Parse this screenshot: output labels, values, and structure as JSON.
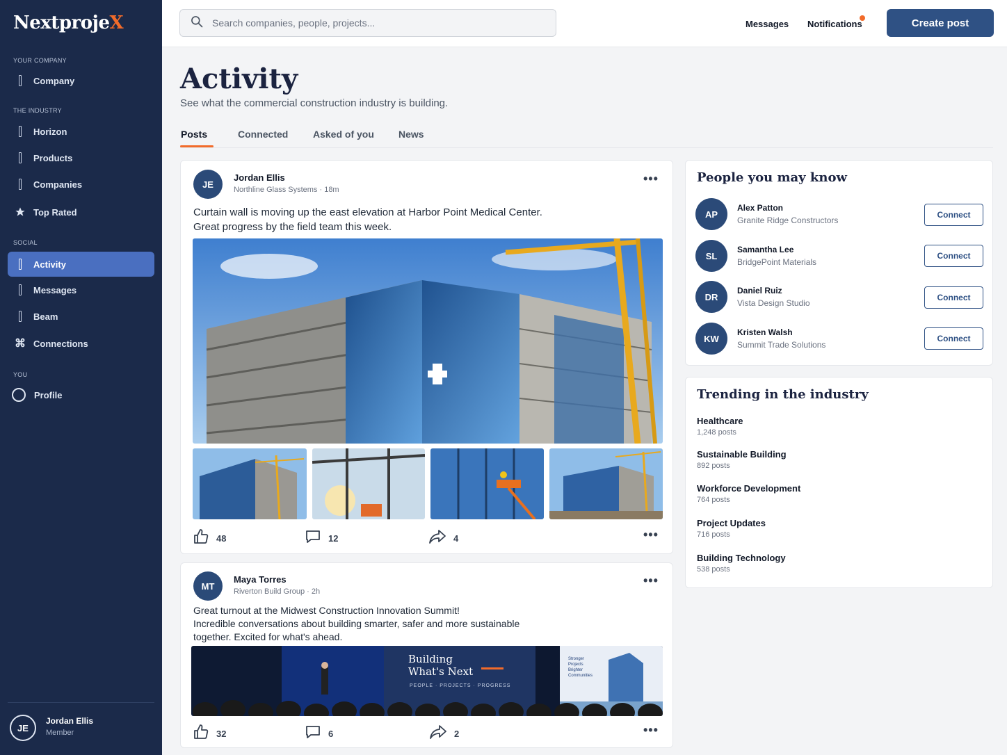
{
  "brand": {
    "logo_main": "Nextproje",
    "logo_x": "X",
    "accent": "#f26b2a",
    "primary": "#2f5184",
    "sidebar_bg": "#1b2a4a"
  },
  "sidebar": {
    "sections": {
      "company": "YOUR COMPANY",
      "industry": "THE INDUSTRY",
      "social": "SOCIAL",
      "you": "YOU"
    },
    "items": [
      {
        "label": "Company",
        "icon": "bar-icon"
      },
      {
        "label": "Horizon",
        "icon": "bar-icon"
      },
      {
        "label": "Products",
        "icon": "bar-icon"
      },
      {
        "label": "Companies",
        "icon": "bar-icon"
      },
      {
        "label": "Top Rated",
        "icon": "star-icon"
      },
      {
        "label": "Activity",
        "icon": "bar-icon",
        "active": true
      },
      {
        "label": "Messages",
        "icon": "bar-icon"
      },
      {
        "label": "Beam",
        "icon": "bar-icon"
      },
      {
        "label": "Connections",
        "icon": "command-icon"
      },
      {
        "label": "Profile",
        "icon": "circle-icon"
      }
    ],
    "user": {
      "initials": "JE",
      "name": "Jordan Ellis",
      "role": "Member"
    }
  },
  "topbar": {
    "search_placeholder": "Search companies, people, projects...",
    "messages": "Messages",
    "notifications": "Notifications",
    "create": "Create post"
  },
  "main": {
    "title": "Activity",
    "subtitle": "See what the commercial construction industry is building.",
    "tabs": [
      "Posts",
      "Connected",
      "Asked of you",
      "News"
    ]
  },
  "posts": [
    {
      "initials": "JE",
      "name": "Jordan Ellis",
      "meta": "Northline Glass Systems · 18m",
      "text_1": "Curtain wall is moving up the east elevation at Harbor Point Medical Center.",
      "text_2": "Great progress by the field team this week.",
      "likes": "48",
      "comments": "12",
      "shares": "4"
    },
    {
      "initials": "MT",
      "name": "Maya Torres",
      "meta": "Riverton Build Group · 2h",
      "text_1": "Great turnout at the Midwest Construction Innovation Summit!",
      "text_2": "Incredible conversations about building smarter, safer and more sustainable",
      "text_3": "together. Excited for what's ahead.",
      "banner_1": "Building",
      "banner_2": "What's Next",
      "banner_tags": "PEOPLE  ·  PROJECTS  ·  PROGRESS",
      "side_banner": [
        "Stronger",
        "Projects",
        "Brighter",
        "Communities"
      ],
      "likes": "32",
      "comments": "6",
      "shares": "2"
    }
  ],
  "people": {
    "title": "People you may know",
    "connect_label": "Connect",
    "list": [
      {
        "initials": "AP",
        "name": "Alex Patton",
        "company": "Granite Ridge Constructors"
      },
      {
        "initials": "SL",
        "name": "Samantha Lee",
        "company": "BridgePoint Materials"
      },
      {
        "initials": "DR",
        "name": "Daniel Ruiz",
        "company": "Vista Design Studio"
      },
      {
        "initials": "KW",
        "name": "Kristen Walsh",
        "company": "Summit Trade Solutions"
      }
    ]
  },
  "trending": {
    "title": "Trending in the industry",
    "list": [
      {
        "name": "Healthcare",
        "count": "1,248 posts"
      },
      {
        "name": "Sustainable Building",
        "count": "892 posts"
      },
      {
        "name": "Workforce Development",
        "count": "764 posts"
      },
      {
        "name": "Project Updates",
        "count": "716 posts"
      },
      {
        "name": "Building Technology",
        "count": "538 posts"
      }
    ]
  }
}
